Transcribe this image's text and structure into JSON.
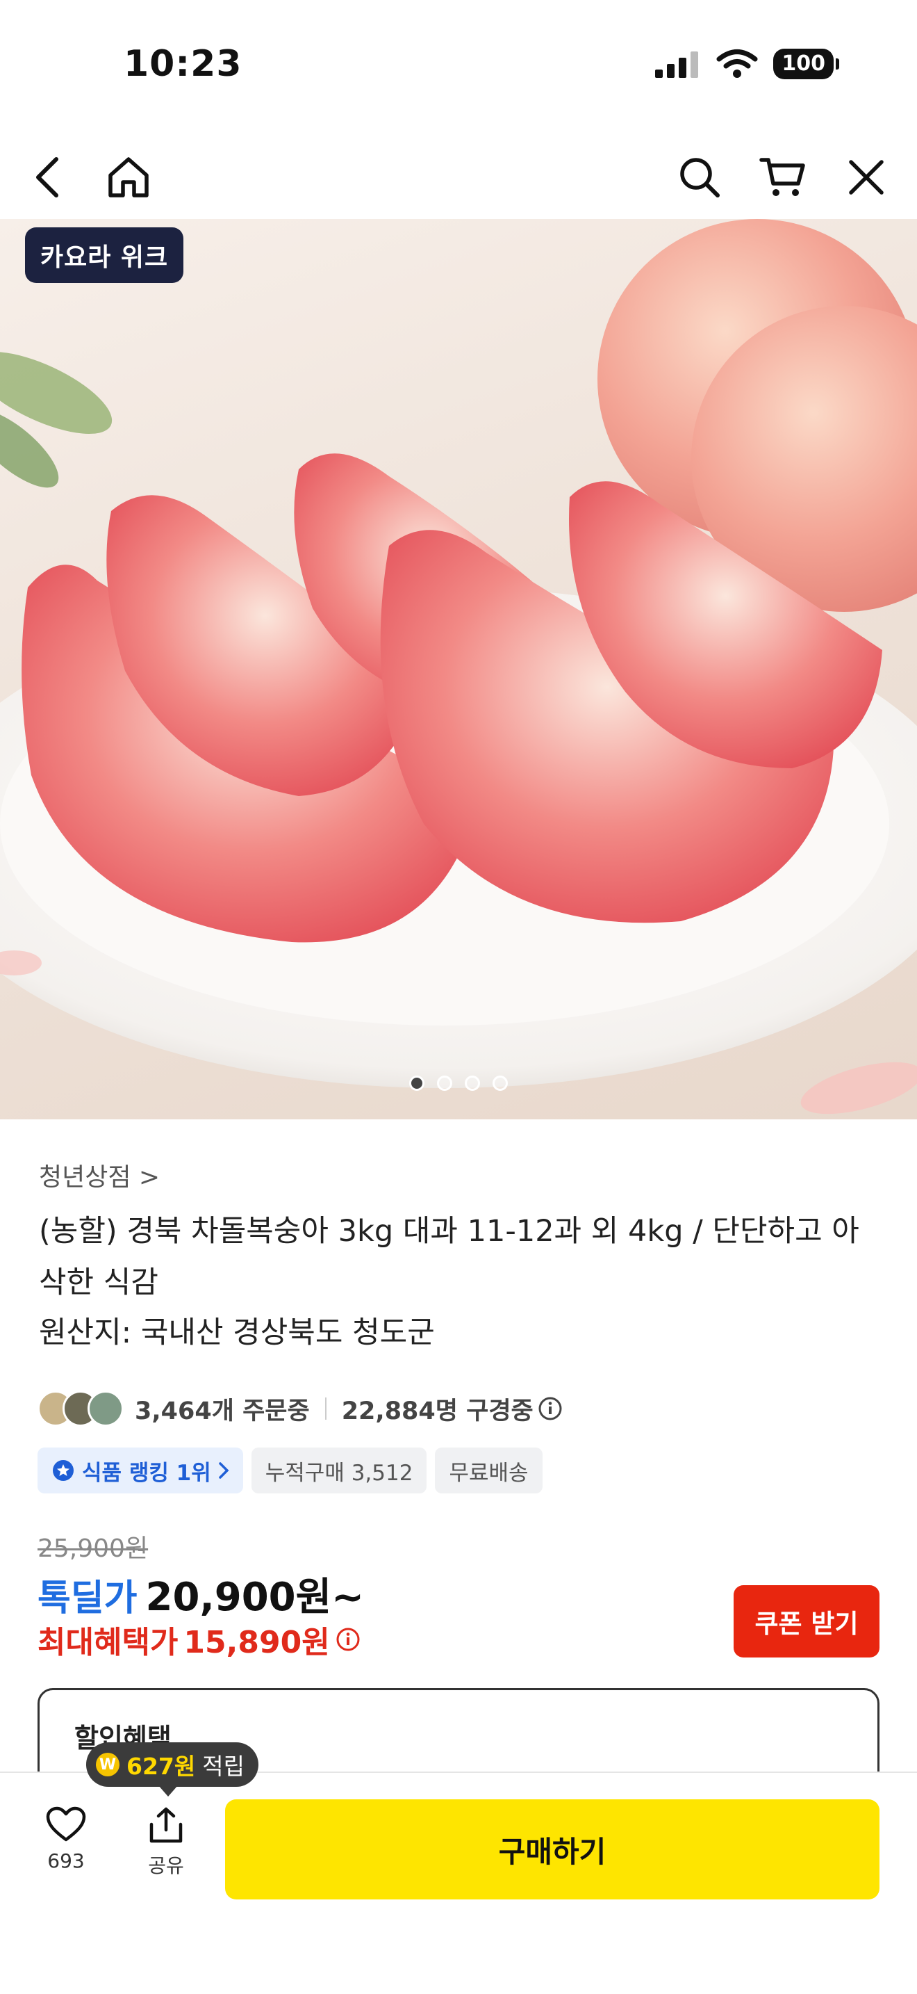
{
  "status_bar": {
    "time": "10:23",
    "battery": "100"
  },
  "nav": {
    "icons": [
      "back-icon",
      "home-icon",
      "search-icon",
      "cart-icon",
      "close-icon"
    ]
  },
  "hero": {
    "badge": "카요라 위크",
    "dots_total": 4,
    "dots_active": 1
  },
  "product": {
    "store": "청년상점 >",
    "title": "(농할) 경북 차돌복숭아 3kg 대과 11-12과 외 4kg / 단단하고 아삭한 식감",
    "origin": "원산지: 국내산 경상북도 청도군",
    "orders": "3,464개 주문중",
    "watching": "22,884명 구경중",
    "chips": {
      "rank": "식품 랭킹 1위",
      "cumulative": "누적구매 3,512",
      "shipping": "무료배송"
    },
    "original_price": "25,900원",
    "deal_label": "톡딜가",
    "deal_price": "20,900원~",
    "max_benefit_label": "최대혜택가",
    "max_benefit_price": "15,890원",
    "coupon_button": "쿠폰 받기",
    "discount_title": "할인혜택"
  },
  "bottom_bar": {
    "points_amount": "627원",
    "points_suffix": "적립",
    "like_count": "693",
    "share_label": "공유",
    "buy_label": "구매하기"
  },
  "colors": {
    "buy_button": "#fee500",
    "coupon_button": "#e8260f",
    "deal_blue": "#1f6de0",
    "benefit_red": "#e02a1b"
  }
}
